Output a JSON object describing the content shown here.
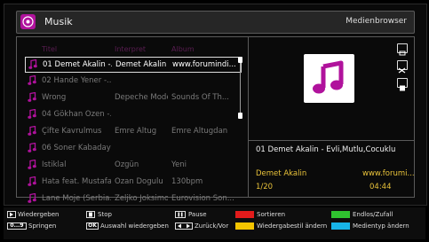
{
  "header": {
    "title": "Musik",
    "right_label": "Medienbrowser"
  },
  "columns": {
    "title": "Titel",
    "artist": "Interpret",
    "album": "Album"
  },
  "tracks": [
    {
      "title": "01 Demet Akalin -...",
      "artist": "Demet Akalin",
      "album": "www.forumindi..."
    },
    {
      "title": "02 Hande Yener -...",
      "artist": "",
      "album": ""
    },
    {
      "title": "Wrong",
      "artist": "Depeche Mode",
      "album": "Sounds Of Th..."
    },
    {
      "title": "04 Gökhan Özen -...",
      "artist": "",
      "album": ""
    },
    {
      "title": "Çifte Kavrulmus",
      "artist": "Emre Altug",
      "album": "Emre Altugdan"
    },
    {
      "title": "06 Soner Kabadayi...",
      "artist": "",
      "album": ""
    },
    {
      "title": "Istiklal",
      "artist": "Özgün",
      "album": "Yeni"
    },
    {
      "title": "Hata feat. Mustafa...",
      "artist": "Ozan Dogulu",
      "album": "130bpm"
    },
    {
      "title": "Lane Moje (Serbia...",
      "artist": "Zeljko Joksimo...",
      "album": "Eurovision Son..."
    }
  ],
  "now_playing": {
    "title": "01 Demet Akalin - Evli,Mutlu,Cocuklu",
    "artist": "Demet Akalin",
    "album": "www.forumi...",
    "position": "1/20",
    "time": "04:44"
  },
  "footer": {
    "play": "Wiedergeben",
    "jump_key": "0...9",
    "jump": "Springen",
    "stop": "Stop",
    "ok_key": "OK",
    "play_selection": "Auswahl wiedergeben",
    "pause": "Pause",
    "prev_next": "Zurück/Vor",
    "sort": "Sortieren",
    "repeat_mode": "Wiedergabestil ändern",
    "loop_shuffle": "Endlos/Zufall",
    "media_type": "Medientyp ändern"
  },
  "colors": {
    "accent": "#b0129c",
    "red": "#e21b1b",
    "green": "#2fc22f",
    "yellow": "#f3c400",
    "cyan": "#18b4e8",
    "info_yellow": "#e8c23a"
  },
  "icons": [
    "music-note-icon",
    "screen-icon",
    "shuffle-icon",
    "stop-icon",
    "play-icon",
    "pause-icon",
    "prev-next-icon"
  ]
}
